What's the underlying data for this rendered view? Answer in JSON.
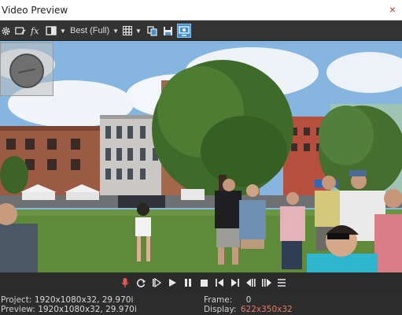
{
  "window": {
    "title": "Video Preview",
    "close_glyph": "×"
  },
  "toolbar": {
    "quality_label": "Best (Full)",
    "icons": [
      "gear-icon",
      "project-properties-icon",
      "fx-icon",
      "split-screen-icon",
      "dropdown-icon",
      "quality-dropdown",
      "overlays-icon",
      "copy-snapshot-icon",
      "save-snapshot-icon",
      "external-monitor-icon"
    ]
  },
  "transport": {
    "icons": [
      "record-icon",
      "loop-icon",
      "play-from-start-icon",
      "play-icon",
      "pause-icon",
      "stop-icon",
      "prev-frame-icon",
      "next-frame-icon",
      "prev-marker-icon",
      "next-marker-icon",
      "menu-icon"
    ]
  },
  "status": {
    "project_label": "Project:",
    "project_value": "1920x1080x32, 29.970i",
    "preview_label": "Preview:",
    "preview_value": "1920x1080x32, 29.970i",
    "frame_label": "Frame:",
    "frame_value": "0",
    "display_label": "Display:",
    "display_value": "622x350x32"
  },
  "colors": {
    "accent": "#3f8fd2",
    "display_value": "#e87b6a",
    "panel": "#2d2d2d"
  }
}
